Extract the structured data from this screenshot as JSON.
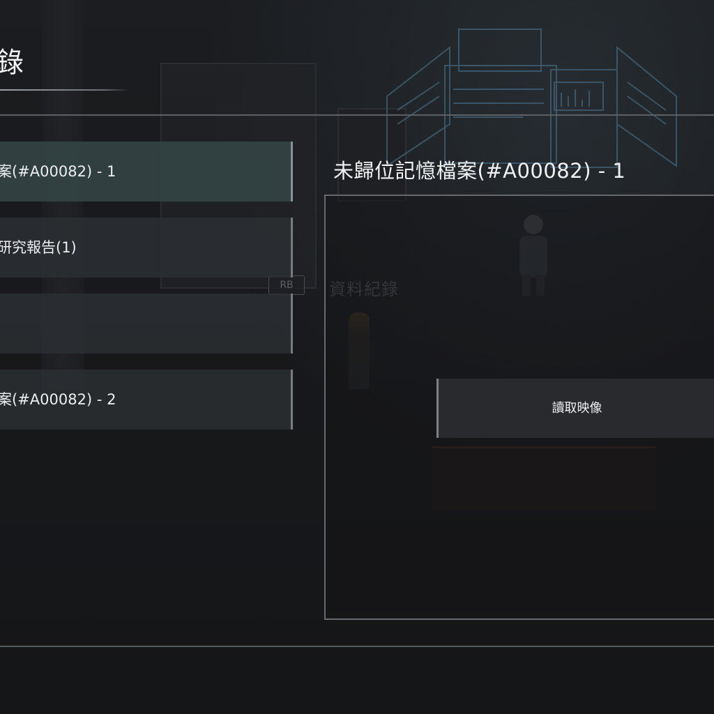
{
  "screen": {
    "title_char": "錄"
  },
  "background": {
    "prompt_button": "RB",
    "prompt_text": "資料紀錄"
  },
  "record_list": {
    "items": [
      {
        "label": "案(#A00082) - 1",
        "selected": true
      },
      {
        "label": "研究報告(1)",
        "selected": false
      },
      {
        "label": "",
        "selected": false
      },
      {
        "label": "案(#A00082) - 2",
        "selected": false
      }
    ]
  },
  "detail": {
    "title": "未歸位記憶檔案(#A00082) - 1",
    "read_button_label": "讀取映像"
  },
  "colors": {
    "selected_item": "#344446",
    "item": "#2c2f33",
    "frame": "#5d6166",
    "hologram": "#5b8fb0"
  }
}
